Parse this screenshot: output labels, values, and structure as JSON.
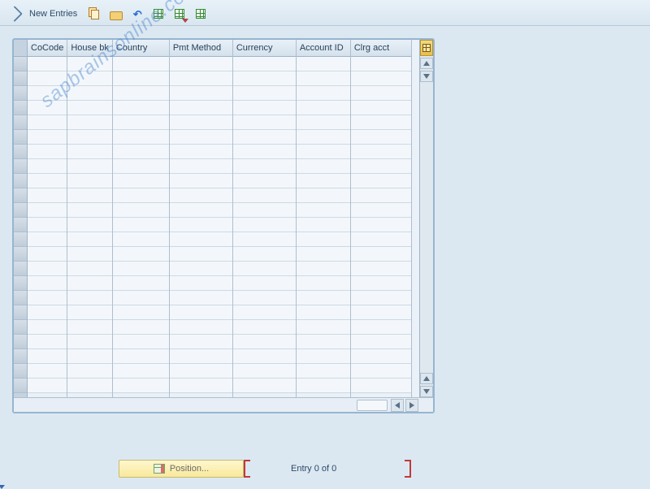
{
  "toolbar": {
    "new_entries_label": "New Entries"
  },
  "table": {
    "columns": [
      "CoCode",
      "House bk",
      "Country",
      "Pmt Method",
      "Currency",
      "Account ID",
      "Clrg acct"
    ],
    "visible_row_count": 23
  },
  "footer": {
    "position_label": "Position...",
    "entry_text": "Entry 0 of 0"
  },
  "watermark": "sapbrainsonline.com"
}
